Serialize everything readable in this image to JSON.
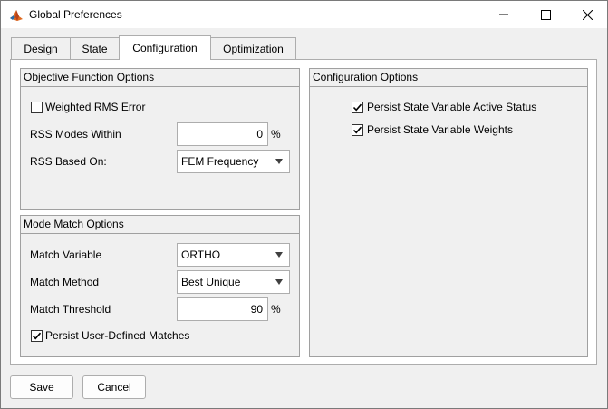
{
  "window": {
    "title": "Global Preferences",
    "minimize_glyph": "—",
    "maximize_glyph": "☐",
    "close_glyph": "✕"
  },
  "tabs": [
    {
      "label": "Design",
      "active": false
    },
    {
      "label": "State",
      "active": false
    },
    {
      "label": "Configuration",
      "active": true
    },
    {
      "label": "Optimization",
      "active": false
    }
  ],
  "objective": {
    "title": "Objective Function Options",
    "weighted_rms_label": "Weighted RMS Error",
    "weighted_rms_checked": false,
    "rss_modes_label": "RSS Modes Within",
    "rss_modes_value": "0",
    "rss_modes_unit": "%",
    "rss_based_label": "RSS Based On:",
    "rss_based_value": "FEM Frequency"
  },
  "mode_match": {
    "title": "Mode Match Options",
    "match_variable_label": "Match Variable",
    "match_variable_value": "ORTHO",
    "match_method_label": "Match Method",
    "match_method_value": "Best Unique",
    "match_threshold_label": "Match Threshold",
    "match_threshold_value": "90",
    "match_threshold_unit": "%",
    "persist_matches_label": "Persist User-Defined Matches",
    "persist_matches_checked": true
  },
  "configuration": {
    "title": "Configuration Options",
    "persist_active_label": "Persist State Variable Active Status",
    "persist_active_checked": true,
    "persist_weights_label": "Persist State Variable Weights",
    "persist_weights_checked": true
  },
  "footer": {
    "save_label": "Save",
    "cancel_label": "Cancel"
  }
}
